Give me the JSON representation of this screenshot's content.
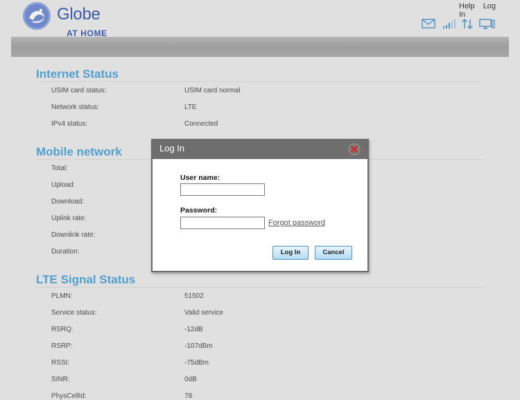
{
  "header": {
    "brand_name": "Globe",
    "brand_sub": "AT HOME",
    "links": {
      "help": "Help",
      "login": "Log In"
    },
    "icons": [
      "mail-icon",
      "signal-icon",
      "data-transfer-icon",
      "device-icon"
    ],
    "brand_color": "#3d5aa7",
    "accent_color": "#4f9fcf"
  },
  "internet_status": {
    "title": "Internet Status",
    "rows": [
      {
        "label": "USIM card status:",
        "value": "USIM card normal"
      },
      {
        "label": "Network status:",
        "value": "LTE"
      },
      {
        "label": "IPv4 status:",
        "value": "Connected"
      }
    ]
  },
  "mobile_network": {
    "title": "Mobile network",
    "rows": [
      {
        "label": "Total:",
        "value": ""
      },
      {
        "label": "Upload:",
        "value": ""
      },
      {
        "label": "Download:",
        "value": ""
      },
      {
        "label": "Uplink rate:",
        "value": ""
      },
      {
        "label": "Downlink rate:",
        "value": ""
      },
      {
        "label": "Duration:",
        "value": ""
      }
    ]
  },
  "lte_signal": {
    "title": "LTE Signal Status",
    "rows": [
      {
        "label": "PLMN:",
        "value": "51502"
      },
      {
        "label": "Service status:",
        "value": "Valid service"
      },
      {
        "label": "RSRQ:",
        "value": "-12dB"
      },
      {
        "label": "RSRP:",
        "value": "-107dBm"
      },
      {
        "label": "RSSI:",
        "value": "-75dBm"
      },
      {
        "label": "SINR:",
        "value": "0dB"
      },
      {
        "label": "PhysCellId:",
        "value": "78"
      }
    ]
  },
  "login_dialog": {
    "title": "Log In",
    "username_label": "User name:",
    "username_value": "",
    "password_label": "Password:",
    "password_value": "",
    "forgot_link": "Forgot password",
    "login_button": "Log In",
    "cancel_button": "Cancel"
  }
}
